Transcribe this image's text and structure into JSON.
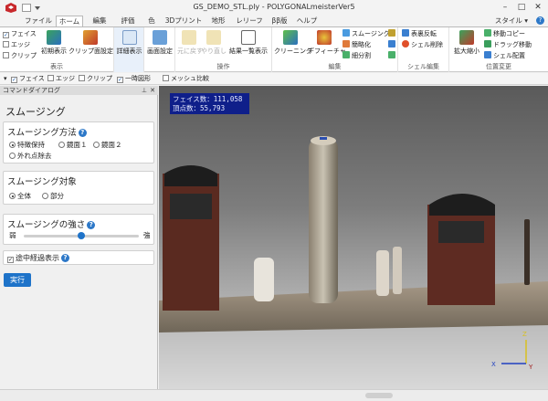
{
  "window": {
    "title": "GS_DEMO_STL.ply - POLYGONALmeisterVer5",
    "controls": [
      "minimize-icon",
      "maximize-icon",
      "close-icon"
    ]
  },
  "tabs": [
    {
      "label": "ファイル",
      "active": false
    },
    {
      "label": "ホーム",
      "active": true
    },
    {
      "label": "編集",
      "active": false
    },
    {
      "label": "評価",
      "active": false
    },
    {
      "label": "色",
      "active": false
    },
    {
      "label": "3Dプリント",
      "active": false
    },
    {
      "label": "地形",
      "active": false
    },
    {
      "label": "レリーフ",
      "active": false
    },
    {
      "label": "ββ版",
      "active": false
    },
    {
      "label": "ヘルプ",
      "active": false
    }
  ],
  "style_menu": "スタイル",
  "ribbon": {
    "display": {
      "label": "表示",
      "checks": [
        {
          "label": "フェイス",
          "checked": true
        },
        {
          "label": "エッジ",
          "checked": false
        },
        {
          "label": "クリップ",
          "checked": false
        }
      ],
      "initial_view": "初期表示",
      "clip_setting": "クリップ面設定"
    },
    "detail_view": "詳細表示",
    "screen_setting": "画面設定",
    "operation": {
      "label": "操作",
      "undo": "元に戻す",
      "redo": "やり直し",
      "result_list": "結果一覧表示"
    },
    "edit": {
      "label": "編集",
      "cleaning": "クリーニング",
      "defeature": "デフィーチャ",
      "smoothing": "スムージング",
      "simplify": "簡略化",
      "subdivide": "細分割"
    },
    "shell": {
      "label": "シェル編集",
      "reverse": "表裏反転",
      "delete": "シェル削除"
    },
    "position": {
      "label": "位置変更",
      "zoom": "拡大縮小",
      "move_copy": "移動コピー",
      "drag_move": "ドラッグ移動",
      "shell_place": "シェル配置"
    }
  },
  "toolbar": {
    "items": [
      "フェイス",
      "エッジ",
      "クリップ",
      "一時図形",
      "メッシュ比較"
    ]
  },
  "panel": {
    "header": "コマンドダイアログ",
    "title": "スムージング",
    "method": {
      "title": "スムージング方法",
      "options": [
        "特徴保持",
        "鏡面１",
        "鏡面２",
        "外れ点除去"
      ],
      "selected": "特徴保持"
    },
    "target": {
      "title": "スムージング対象",
      "options": [
        "全体",
        "部分"
      ],
      "selected": "全体"
    },
    "strength": {
      "title": "スムージングの強さ",
      "weak": "弱",
      "strong": "強",
      "value": 0.5
    },
    "progress_display": {
      "label": "途中経過表示",
      "checked": true
    },
    "run_button": "実行"
  },
  "viewport": {
    "stats_faces": "フェイス数：111,058",
    "stats_vertices": "頂点数：55,793",
    "axis_x": "X",
    "axis_y": "Y",
    "axis_z": "Z"
  },
  "colors": {
    "accent": "#1e73c9",
    "stats_bg": "#0f1f8a"
  }
}
